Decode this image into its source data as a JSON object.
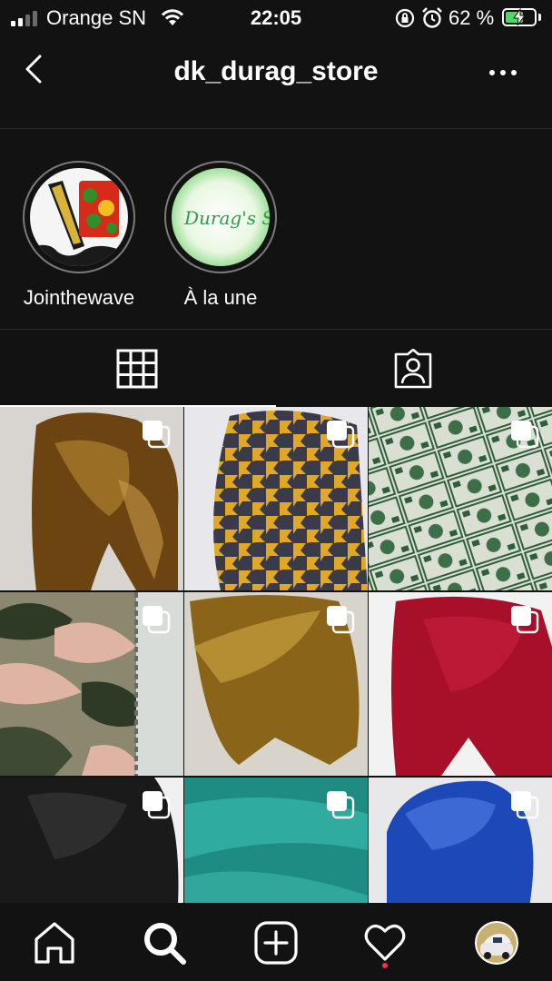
{
  "status_bar": {
    "carrier": "Orange SN",
    "time": "22:05",
    "battery_percent": "62 %",
    "battery_level": 0.62,
    "signal_bars": 2
  },
  "header": {
    "title": "dk_durag_store"
  },
  "highlights": [
    {
      "label": "Jointhewave"
    },
    {
      "label": "À la une",
      "thumb_text": "Durag's Store"
    }
  ],
  "tabs": [
    {
      "name": "posts",
      "icon": "grid-icon",
      "active": true
    },
    {
      "name": "tagged",
      "icon": "tagged-person-icon",
      "active": false
    }
  ],
  "posts": [
    {
      "description": "bronze satin durag",
      "color": "#7a5418",
      "multi": true
    },
    {
      "description": "houndstooth durag",
      "color": "#2a2a36",
      "multi": true
    },
    {
      "description": "dollar print durag",
      "color": "#cfd6c9",
      "multi": true
    },
    {
      "description": "camo durag",
      "color": "#6b6a50",
      "multi": true
    },
    {
      "description": "gold velvet durag",
      "color": "#8a6418",
      "multi": true
    },
    {
      "description": "red velvet durag",
      "color": "#a8102a",
      "multi": true
    },
    {
      "description": "black velvet durag",
      "color": "#1a1a1a",
      "multi": true
    },
    {
      "description": "teal satin durag",
      "color": "#2aa59a",
      "multi": true
    },
    {
      "description": "royal blue satin durag",
      "color": "#1c48b8",
      "multi": true
    }
  ],
  "bottom_nav": [
    {
      "icon": "home-icon"
    },
    {
      "icon": "search-icon",
      "active": true
    },
    {
      "icon": "new-post-icon"
    },
    {
      "icon": "activity-heart-icon",
      "has_notification": true
    },
    {
      "icon": "profile-avatar-icon"
    }
  ],
  "colors": {
    "background": "#121212",
    "divider": "#2a2a2a",
    "battery_fill": "#4cd964",
    "notification_dot": "#ff3040"
  }
}
